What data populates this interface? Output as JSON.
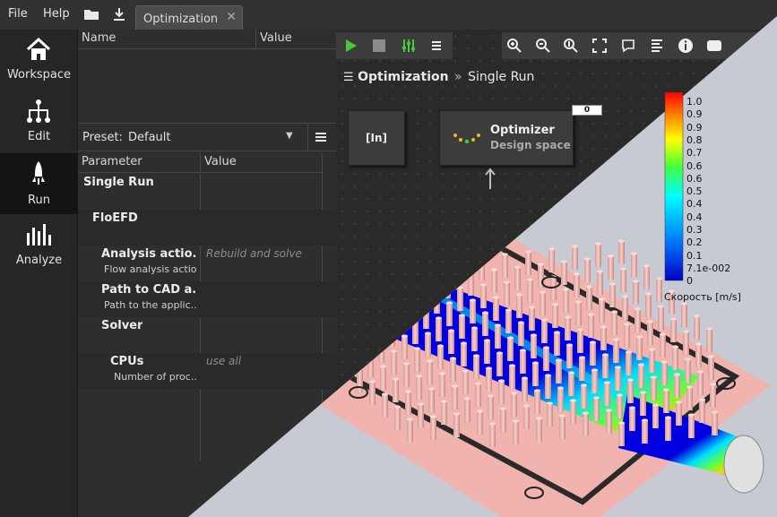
{
  "menu": {
    "file": "File",
    "help": "Help"
  },
  "tab": {
    "label": "Optimization"
  },
  "sidebar": {
    "items": [
      {
        "label": "Workspace"
      },
      {
        "label": "Edit"
      },
      {
        "label": "Run"
      },
      {
        "label": "Analyze"
      }
    ]
  },
  "outline": {
    "col_name": "Name",
    "col_value": "Value"
  },
  "preset": {
    "label": "Preset:",
    "value": "Default"
  },
  "params": {
    "col_param": "Parameter",
    "col_value": "Value",
    "rows": [
      {
        "name": "Single Run",
        "desc": "",
        "value": ""
      },
      {
        "name": "FloEFD",
        "desc": "",
        "value": ""
      },
      {
        "name": "Analysis actio...",
        "desc": "Flow analysis actio...",
        "value": "Rebuild and solve"
      },
      {
        "name": "Path to CAD a...",
        "desc": "Path to the applic...",
        "value": ""
      },
      {
        "name": "Solver",
        "desc": "",
        "value": ""
      },
      {
        "name": "CPUs",
        "desc": "Number of proc...",
        "value": "use all"
      }
    ]
  },
  "canvas": {
    "breadcrumb_root": "Optimization",
    "breadcrumb_sep": "»",
    "breadcrumb_leaf": "Single Run",
    "node_in": "[In]",
    "optimizer_title": "Optimizer",
    "optimizer_sub": "Design space",
    "optimizer_badge": "0"
  },
  "colorbar": {
    "ticks": [
      "1.0",
      "0.9",
      "0.9",
      "0.8",
      "0.7",
      "0.6",
      "0.6",
      "0.5",
      "0.4",
      "0.4",
      "0.3",
      "0.2",
      "0.1",
      "7.1e-002",
      "0"
    ],
    "title": "Скорость [m/s]"
  },
  "colors": {
    "accent_green": "#46c93a",
    "plate": "#f0b3ad",
    "background_overlay": "#c8cad3"
  }
}
